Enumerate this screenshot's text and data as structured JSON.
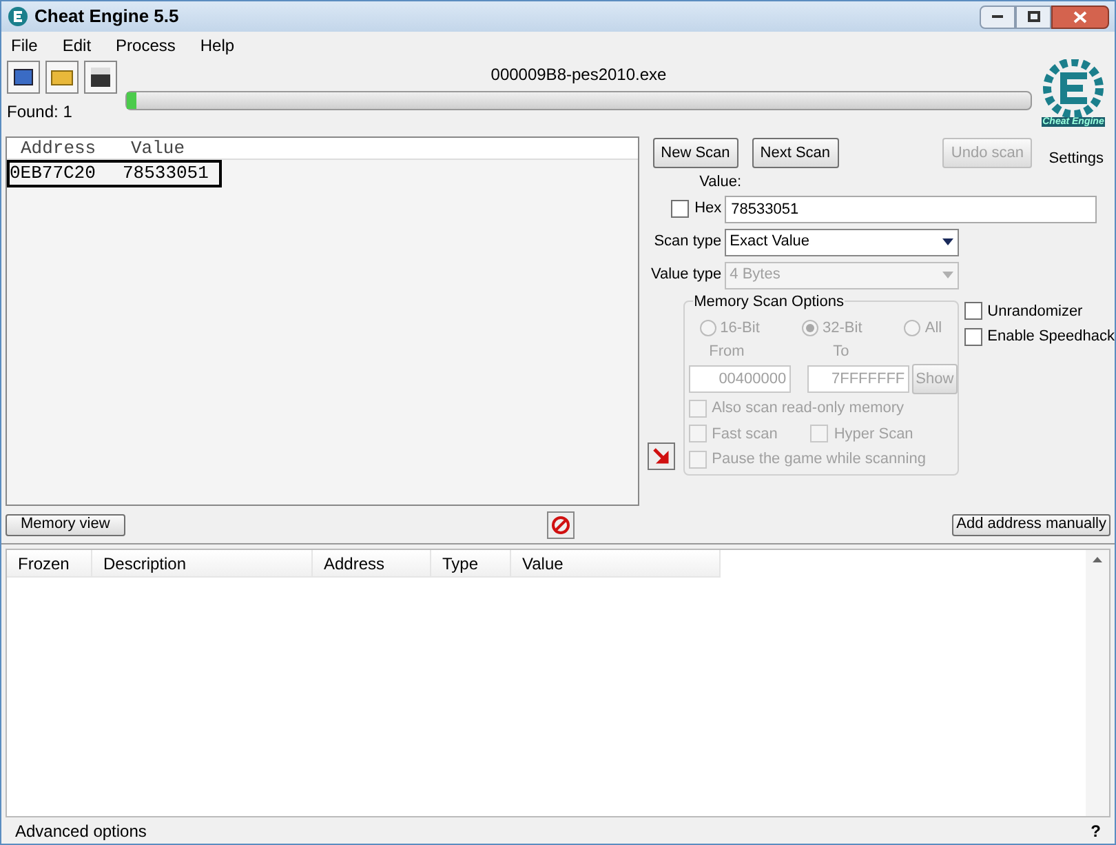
{
  "window": {
    "title": "Cheat Engine 5.5"
  },
  "menu": [
    "File",
    "Edit",
    "Process",
    "Help"
  ],
  "process_name": "000009B8-pes2010.exe",
  "progress": {
    "level": 0.01
  },
  "found": "Found: 1",
  "results": {
    "columns": [
      "Address",
      "Value"
    ],
    "rows": [
      {
        "address": "0EB77C20",
        "value": "78533051",
        "selected": true
      }
    ]
  },
  "scan_buttons": [
    {
      "label": "New Scan",
      "disabled": false
    },
    {
      "label": "Next Scan",
      "disabled": false
    },
    {
      "label": "Undo scan",
      "disabled": true
    }
  ],
  "logo_text": "Cheat Engine",
  "settings": "Settings",
  "value_label": "Value:",
  "hex": {
    "label": "Hex",
    "checked": false
  },
  "value": "78533051",
  "scan_type": {
    "label": "Scan type",
    "value": "Exact Value",
    "disabled": false
  },
  "value_type": {
    "label": "Value type",
    "value": "4 Bytes",
    "disabled": true
  },
  "memory_options": {
    "title": "Memory Scan Options",
    "radios": [
      {
        "label": "16-Bit",
        "selected": false
      },
      {
        "label": "32-Bit",
        "selected": true
      },
      {
        "label": "All",
        "selected": false
      }
    ],
    "from_label": "From",
    "to_label": "To",
    "from": "00400000",
    "to": "7FFFFFFF",
    "show": "Show",
    "checks": [
      {
        "label": "Also scan read-only memory",
        "checked": false
      },
      {
        "label": "Fast scan",
        "checked": false
      },
      {
        "label": "Hyper Scan",
        "checked": false
      },
      {
        "label": "Pause the game while scanning",
        "checked": false
      }
    ]
  },
  "side_checks": [
    {
      "label": "Unrandomizer",
      "checked": false
    },
    {
      "label": "Enable Speedhack",
      "checked": false
    }
  ],
  "memory_view": "Memory view",
  "add_address": "Add address manually",
  "table": {
    "columns": [
      "Frozen",
      "Description",
      "Address",
      "Type",
      "Value"
    ]
  },
  "advanced": "Advanced options",
  "help": "?"
}
